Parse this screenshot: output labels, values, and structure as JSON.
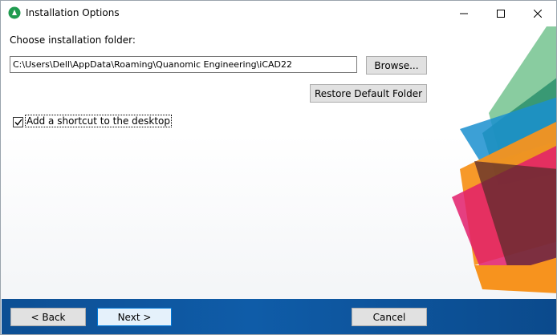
{
  "window": {
    "title": "Installation Options",
    "controls": {
      "minimize": "minimize",
      "maximize": "maximize",
      "close": "close"
    }
  },
  "folder": {
    "label": "Choose installation folder:",
    "path": "C:\\Users\\Dell\\AppData\\Roaming\\Quanomic Engineering\\iCAD22",
    "browse_label": "Browse...",
    "restore_label": "Restore Default Folder"
  },
  "shortcut": {
    "label": "Add a shortcut to the desktop",
    "checked": true
  },
  "footer": {
    "back_label": "< Back",
    "next_label": "Next >",
    "cancel_label": "Cancel"
  },
  "icons": {
    "app": "app-icon",
    "checkmark": "checkmark-icon"
  },
  "colors": {
    "accent": "#0078d7",
    "bottom_bar": "#0f5ca8"
  }
}
